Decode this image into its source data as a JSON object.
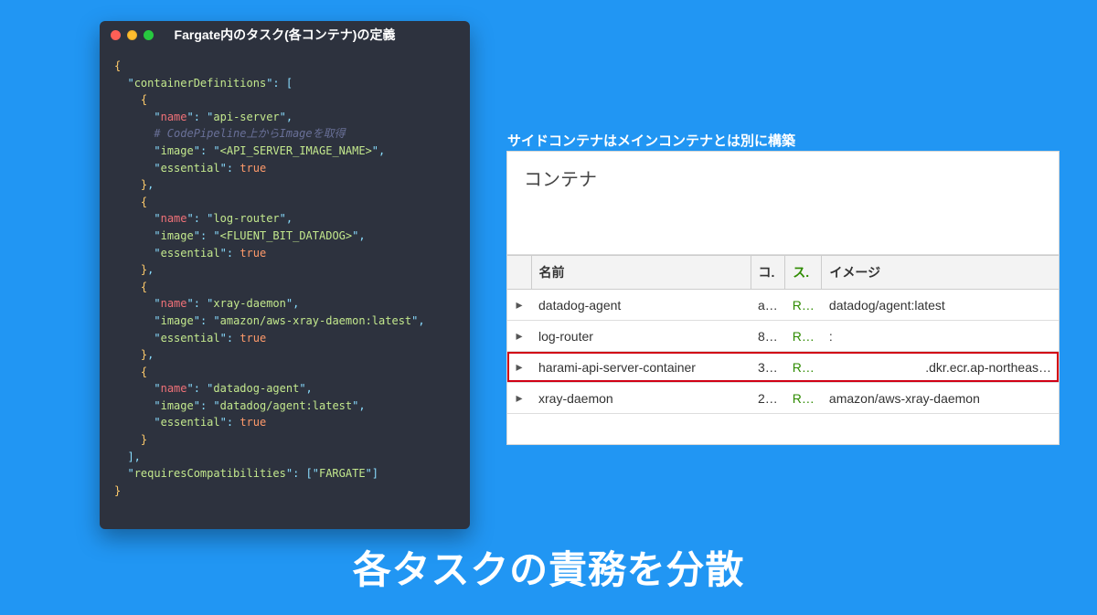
{
  "code_panel": {
    "title": "Fargate内のタスク(各コンテナ)の定義",
    "key_containerDefinitions": "containerDefinitions",
    "key_name": "name",
    "key_image": "image",
    "key_essential": "essential",
    "key_requiresCompatibilities": "requiresCompatibilities",
    "val_true": "true",
    "comment_codepipeline": "# CodePipeline上からImageを取得",
    "containers": [
      {
        "name": "api-server",
        "image": "<API_SERVER_IMAGE_NAME>",
        "comment": true
      },
      {
        "name": "log-router",
        "image": "<FLUENT_BIT_DATADOG>"
      },
      {
        "name": "xray-daemon",
        "image": "amazon/aws-xray-daemon:latest"
      },
      {
        "name": "datadog-agent",
        "image": "datadog/agent:latest"
      }
    ],
    "compat_value": "FARGATE"
  },
  "right": {
    "caption": "サイドコンテナはメインコンテナとは別に構築",
    "panel_title": "コンテナ",
    "columns": {
      "name": "名前",
      "co": "コ.",
      "su": "ス.",
      "image": "イメージ"
    },
    "rows": [
      {
        "name": "datadog-agent",
        "co": "a…",
        "su": "R…",
        "image": "datadog/agent:latest"
      },
      {
        "name": "log-router",
        "co": "8…",
        "su": "R…",
        "image": ":"
      },
      {
        "name": "harami-api-server-container",
        "co": "3…",
        "su": "R…",
        "image": ".dkr.ecr.ap-northeas…",
        "highlight": true
      },
      {
        "name": "xray-daemon",
        "co": "2…",
        "su": "R…",
        "image": "amazon/aws-xray-daemon"
      }
    ]
  },
  "bottom_caption": "各タスクの責務を分散"
}
